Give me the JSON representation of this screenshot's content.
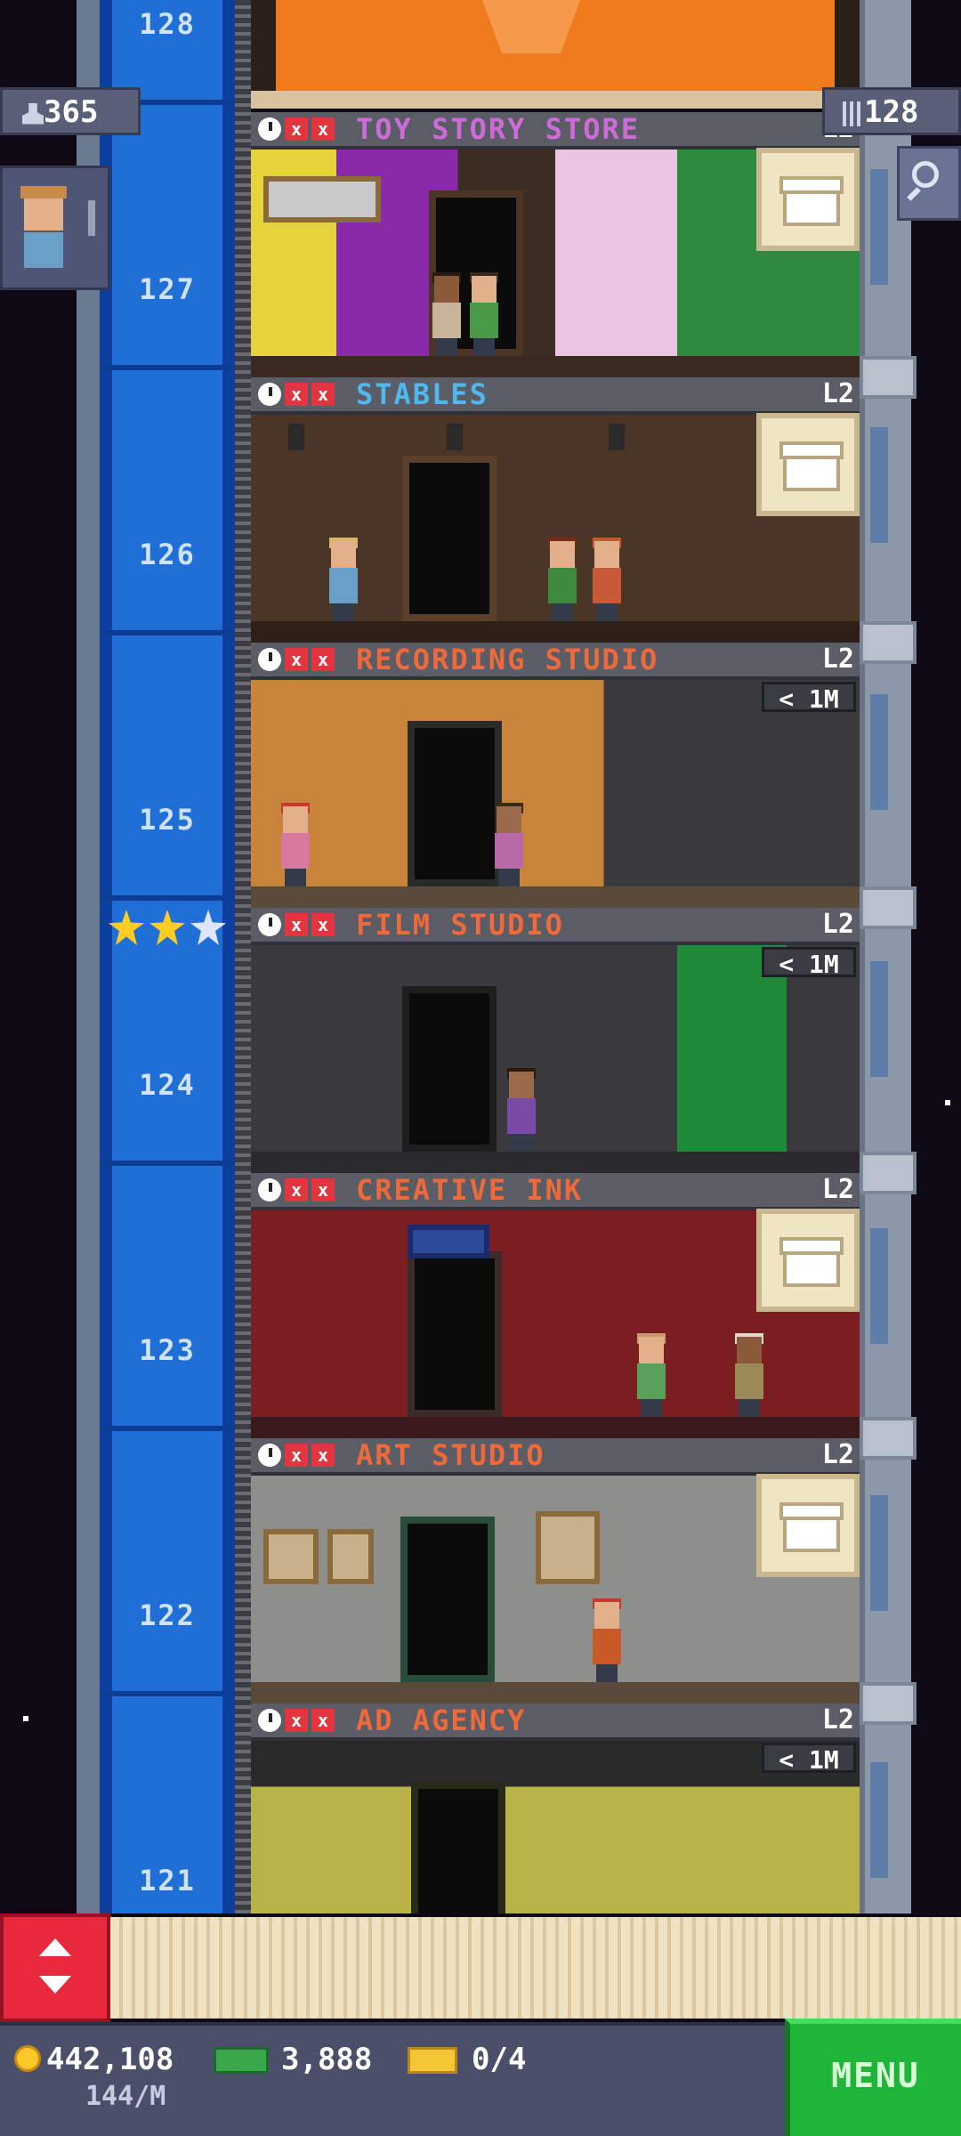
{
  "hud": {
    "population": "365",
    "floors": "128"
  },
  "elevator": {
    "floors": [
      "128",
      "127",
      "126",
      "125",
      "124",
      "123",
      "122",
      "121"
    ]
  },
  "floors": [
    {
      "name": "TOY STORY STORE",
      "level": "L2",
      "color": "#cf6bd8",
      "action": "supply-box"
    },
    {
      "name": "STABLES",
      "level": "L2",
      "color": "#4fb8ef",
      "action": "supply-box"
    },
    {
      "name": "RECORDING STUDIO",
      "level": "L2",
      "color": "#ef6a3a",
      "action": "price",
      "price": "< 1M"
    },
    {
      "name": "FILM STUDIO",
      "level": "L2",
      "color": "#ef6a3a",
      "action": "price",
      "price": "< 1M"
    },
    {
      "name": "CREATIVE INK",
      "level": "L2",
      "color": "#ef6a3a",
      "action": "supply-box"
    },
    {
      "name": "ART STUDIO",
      "level": "L2",
      "color": "#ef6a3a",
      "action": "supply-box"
    },
    {
      "name": "AD AGENCY",
      "level": "L2",
      "color": "#ef6a3a",
      "action": "price",
      "price": "< 1M"
    }
  ],
  "bottom": {
    "coins": "442,108",
    "coin_rate": "144/M",
    "bux": "3,888",
    "tickets": "0/4",
    "menu_label": "MENU"
  },
  "colors": {
    "shaft": "#1f6fd6",
    "menu": "#1fb53b",
    "elevator_button": "#e8283c"
  }
}
